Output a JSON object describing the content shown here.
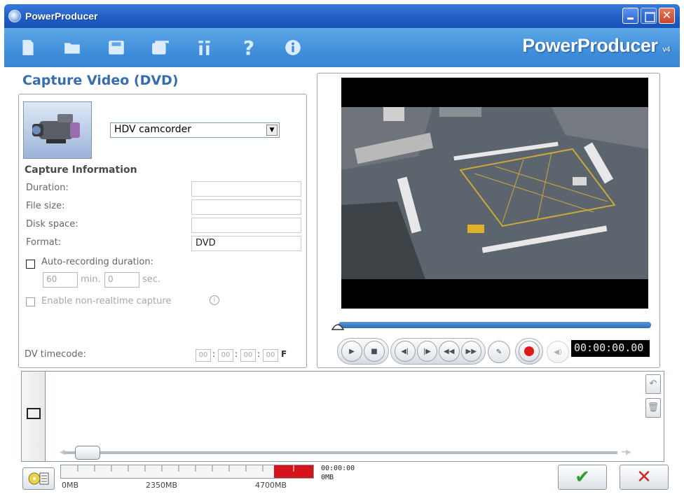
{
  "window": {
    "title": "PowerProducer",
    "close_glyph": "✕"
  },
  "toolbar": {
    "icons": [
      "new-icon",
      "open-folder-icon",
      "save-icon",
      "save-as-icon",
      "settings-icon",
      "help-icon",
      "info-icon"
    ],
    "help_glyph": "?",
    "info_glyph": "i",
    "brand": "PowerProducer",
    "brand_version": "v4"
  },
  "panel": {
    "title": "Capture Video (DVD)",
    "device_selected": "HDV camcorder",
    "capture_info_heading": "Capture Information",
    "fields": {
      "duration_label": "Duration:",
      "duration_value": "",
      "file_size_label": "File size:",
      "file_size_value": "",
      "disk_space_label": "Disk space:",
      "disk_space_value": "",
      "format_label": "Format:",
      "format_value": "DVD"
    },
    "auto_recording": {
      "label": "Auto-recording duration:",
      "minutes": "60",
      "min_label": "min.",
      "seconds": "0",
      "sec_label": "sec."
    },
    "non_realtime_label": "Enable non-realtime capture",
    "dv_timecode_label": "DV timecode:",
    "dv_timecode_fields": [
      "00",
      "00",
      "00",
      "00"
    ],
    "dv_timecode_sep": ":",
    "dv_timecode_suffix": "F"
  },
  "player": {
    "timecode": "00:00:00.00",
    "seek_position": 0
  },
  "bottom": {
    "space_labels": [
      "0MB",
      "2350MB",
      "4700MB"
    ],
    "space_time": "00:00:00",
    "space_used": "0MB",
    "ok_glyph": "✔",
    "cancel_glyph": "✕"
  },
  "colors": {
    "accent": "#356dae",
    "record": "#e01818",
    "ok": "#2f9e2f",
    "cancel": "#d22a2a",
    "overflow_zone": "#d4141c"
  }
}
